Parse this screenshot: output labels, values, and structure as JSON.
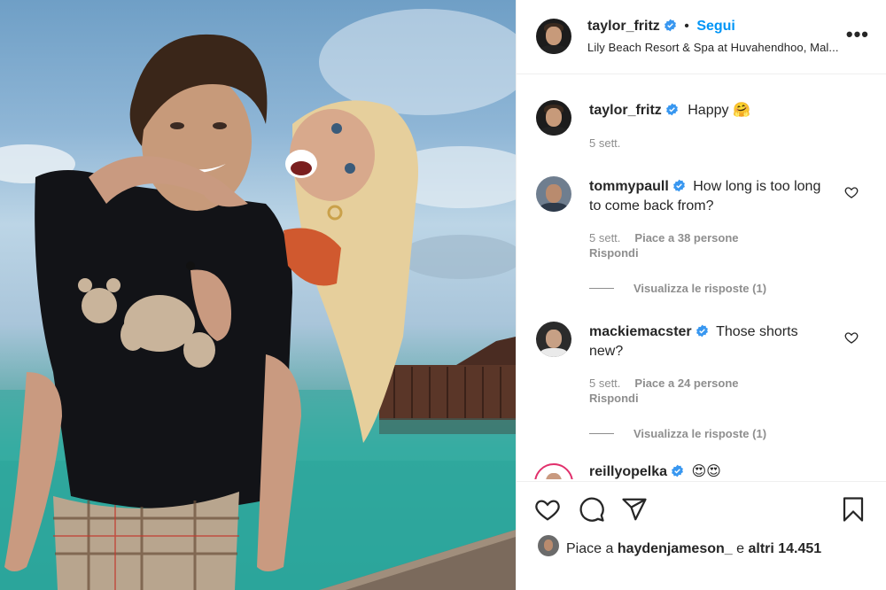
{
  "post": {
    "author": "taylor_fritz",
    "follow_label": "Segui",
    "separator": "•",
    "location": "Lily Beach Resort & Spa at Huvahendhoo, Mal...",
    "more_label": "•••",
    "caption": {
      "user": "taylor_fritz",
      "text": "Happy 🤗",
      "time": "5 sett."
    }
  },
  "comments": [
    {
      "user": "tommypaull",
      "text": "How long is too long to come back from?",
      "time": "5 sett.",
      "likes": "Piace a 38 persone",
      "reply": "Rispondi",
      "view_replies": "Visualizza le risposte (1)"
    },
    {
      "user": "mackiemacster",
      "text": "Those shorts new?",
      "time": "5 sett.",
      "likes": "Piace a 24 persone",
      "reply": "Rispondi",
      "view_replies": "Visualizza le risposte (1)"
    },
    {
      "user": "reillyopelka",
      "text": "😍😍"
    }
  ],
  "footer": {
    "likes_prefix": "Piace a",
    "likes_user": "haydenjameson_",
    "likes_mid": "e",
    "likes_count": "altri 14.451"
  },
  "icons": {
    "like": "heart-icon",
    "comment": "comment-icon",
    "share": "share-icon",
    "save": "bookmark-icon",
    "verified": "verified-badge-icon",
    "options": "more-options-icon"
  },
  "colors": {
    "accent": "#0095f6",
    "secondary_text": "#8e8e8e",
    "divider": "#efefef"
  }
}
